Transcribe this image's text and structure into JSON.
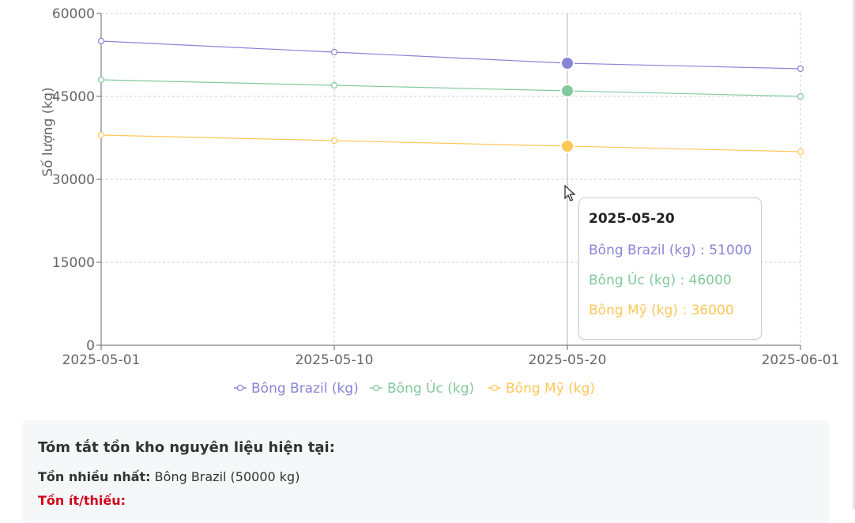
{
  "chart_data": {
    "type": "line",
    "x": [
      "2025-05-01",
      "2025-05-10",
      "2025-05-20",
      "2025-06-01"
    ],
    "series": [
      {
        "name": "Bông Brazil (kg)",
        "color": "#8884d8",
        "values": [
          55000,
          53000,
          51000,
          50000
        ]
      },
      {
        "name": "Bông Úc (kg)",
        "color": "#82ca9d",
        "values": [
          48000,
          47000,
          46000,
          45000
        ]
      },
      {
        "name": "Bông Mỹ (kg)",
        "color": "#ffc658",
        "values": [
          38000,
          37000,
          36000,
          35000
        ]
      }
    ],
    "ylabel": "Số lượng (kg)",
    "ylim": [
      0,
      60000
    ],
    "yticks": [
      0,
      15000,
      30000,
      45000,
      60000
    ],
    "grid": true,
    "legend_position": "bottom",
    "active_index": 2
  },
  "tooltip": {
    "title": "2025-05-20",
    "rows": [
      "Bông Brazil (kg) : 51000",
      "Bông Úc (kg) : 46000",
      "Bông Mỹ (kg) : 36000"
    ]
  },
  "summary": {
    "title": "Tóm tắt tồn kho nguyên liệu hiện tại:",
    "most_label": "Tồn nhiều nhất:",
    "most_value": "Bông Brazil (50000 kg)",
    "least_label": "Tồn ít/thiếu:"
  }
}
